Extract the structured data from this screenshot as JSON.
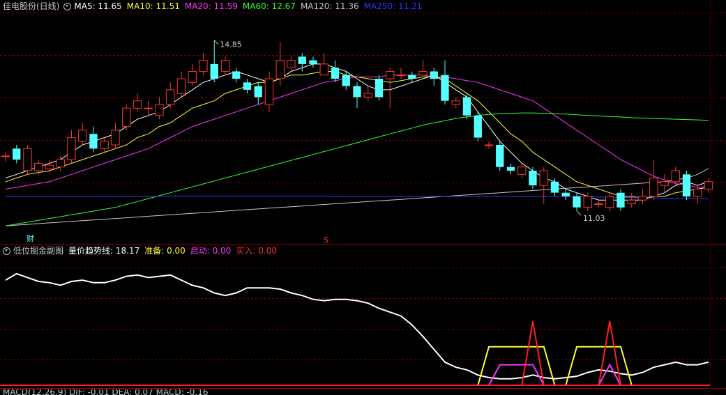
{
  "main_legend": {
    "title": "佳电股份(日线)",
    "ma": [
      {
        "label": "MA5: 11.65",
        "color": "#ffffff"
      },
      {
        "label": "MA10: 11.51",
        "color": "#ffff33"
      },
      {
        "label": "MA20: 11.59",
        "color": "#ff33ff"
      },
      {
        "label": "MA60: 12.67",
        "color": "#33ff33"
      },
      {
        "label": "MA120: 11.36",
        "color": "#c8c8c8"
      },
      {
        "label": "MA250: 11.21",
        "color": "#3333ff"
      }
    ]
  },
  "annotations": {
    "high": "14.85",
    "low": "11.03",
    "marker_cai": "财",
    "marker_s": "S"
  },
  "sub_legend": {
    "title": "低位掘金副图",
    "items": [
      {
        "label": "量价趋势线: 18.17",
        "color": "#ffffff"
      },
      {
        "label": "准备: 0.00",
        "color": "#ffff33"
      },
      {
        "label": "启动: 0.00",
        "color": "#ff33ff"
      },
      {
        "label": "买入: 0.00",
        "color": "#ff3333"
      }
    ]
  },
  "bottom_legend": {
    "text": "MACD(12,26,9) DIF: -0.01 DEA: 0.07 MACD: -0.16"
  },
  "colors": {
    "up": "#ff3333",
    "down": "#54ffff",
    "grid": "#7a0000",
    "border": "#a00000"
  },
  "chart_data": [
    {
      "type": "candlestick",
      "title": "佳电股份(日线)",
      "ylim": [
        9.5,
        15.6
      ],
      "candles": [
        [
          11.7,
          11.7,
          11.8,
          11.55
        ],
        [
          11.9,
          11.6,
          12.0,
          11.5
        ],
        [
          11.3,
          11.9,
          12.0,
          11.2
        ],
        [
          11.3,
          11.5,
          11.6,
          11.2
        ],
        [
          11.35,
          11.45,
          11.6,
          11.25
        ],
        [
          11.4,
          11.6,
          11.7,
          11.3
        ],
        [
          11.6,
          12.2,
          12.4,
          11.5
        ],
        [
          12.1,
          12.4,
          12.6,
          12.0
        ],
        [
          12.3,
          11.9,
          12.5,
          11.8
        ],
        [
          11.9,
          12.1,
          12.2,
          11.8
        ],
        [
          12.0,
          12.4,
          12.6,
          11.9
        ],
        [
          12.5,
          13.0,
          13.1,
          12.4
        ],
        [
          13.0,
          13.2,
          13.4,
          12.9
        ],
        [
          13.0,
          13.0,
          13.2,
          12.8
        ],
        [
          12.8,
          13.1,
          13.3,
          12.7
        ],
        [
          13.1,
          13.5,
          13.7,
          13.0
        ],
        [
          13.4,
          13.8,
          14.0,
          13.3
        ],
        [
          13.7,
          14.0,
          14.2,
          13.6
        ],
        [
          14.0,
          14.3,
          14.5,
          13.9
        ],
        [
          14.2,
          13.8,
          14.85,
          13.7
        ],
        [
          14.0,
          14.3,
          14.4,
          13.9
        ],
        [
          14.0,
          13.8,
          14.1,
          13.7
        ],
        [
          13.7,
          13.5,
          13.8,
          13.4
        ],
        [
          13.6,
          13.3,
          13.7,
          13.1
        ],
        [
          13.1,
          13.8,
          14.0,
          12.9
        ],
        [
          13.8,
          14.3,
          14.8,
          13.6
        ],
        [
          14.1,
          14.3,
          14.4,
          14.0
        ],
        [
          14.4,
          14.2,
          14.5,
          14.0
        ],
        [
          14.3,
          14.2,
          14.4,
          14.1
        ],
        [
          13.9,
          14.2,
          14.5,
          13.9
        ],
        [
          14.1,
          13.8,
          14.3,
          13.7
        ],
        [
          13.9,
          13.6,
          14.0,
          13.5
        ],
        [
          13.6,
          13.3,
          13.7,
          13.0
        ],
        [
          13.3,
          13.4,
          13.6,
          13.2
        ],
        [
          13.8,
          13.3,
          13.9,
          13.2
        ],
        [
          13.8,
          14.0,
          14.1,
          13.0
        ],
        [
          13.9,
          13.9,
          14.1,
          13.8
        ],
        [
          13.9,
          13.8,
          14.0,
          13.7
        ],
        [
          13.9,
          14.0,
          14.3,
          13.9
        ],
        [
          14.0,
          13.8,
          14.1,
          13.6
        ],
        [
          13.9,
          13.2,
          14.3,
          13.1
        ],
        [
          13.1,
          13.2,
          13.3,
          13.0
        ],
        [
          13.3,
          12.8,
          13.4,
          12.7
        ],
        [
          12.8,
          12.2,
          12.9,
          12.1
        ],
        [
          12.0,
          12.0,
          12.1,
          11.9
        ],
        [
          12.0,
          11.4,
          12.1,
          11.3
        ],
        [
          11.4,
          11.3,
          11.5,
          11.2
        ],
        [
          11.2,
          11.4,
          11.5,
          11.1
        ],
        [
          11.3,
          10.9,
          11.4,
          10.8
        ],
        [
          10.9,
          11.3,
          11.4,
          10.4
        ],
        [
          11.0,
          10.7,
          11.1,
          10.6
        ],
        [
          10.7,
          10.6,
          10.8,
          10.5
        ],
        [
          10.6,
          10.3,
          10.7,
          10.2
        ],
        [
          10.3,
          10.6,
          10.7,
          10.2
        ],
        [
          10.4,
          10.4,
          10.5,
          10.3
        ],
        [
          10.3,
          10.6,
          10.7,
          10.2
        ],
        [
          10.7,
          10.3,
          10.8,
          10.2
        ],
        [
          10.4,
          10.5,
          10.7,
          10.3
        ],
        [
          10.5,
          10.6,
          10.8,
          10.4
        ],
        [
          10.6,
          11.1,
          11.6,
          10.5
        ],
        [
          10.9,
          11.0,
          11.2,
          10.7
        ],
        [
          11.0,
          11.3,
          11.4,
          10.9
        ],
        [
          11.2,
          10.6,
          11.3,
          10.5
        ],
        [
          10.6,
          10.8,
          10.9,
          10.4
        ],
        [
          10.8,
          11.0,
          11.1,
          10.7
        ]
      ],
      "series": [
        {
          "name": "MA5",
          "values": [
            11.1,
            11.2,
            11.3,
            11.4,
            11.5,
            11.6,
            11.8,
            12.0,
            12.1,
            12.2,
            12.3,
            12.5,
            12.7,
            12.8,
            12.9,
            13.1,
            13.3,
            13.5,
            13.7,
            13.8,
            13.9,
            14.0,
            13.9,
            13.8,
            13.7,
            13.8,
            14.0,
            14.1,
            14.2,
            14.2,
            14.1,
            14.0,
            13.8,
            13.6,
            13.5,
            13.5,
            13.6,
            13.7,
            13.8,
            13.9,
            13.7,
            13.5,
            13.3,
            12.9,
            12.5,
            12.1,
            11.8,
            11.5,
            11.3,
            11.1,
            11.0,
            10.8,
            10.7,
            10.6,
            10.5,
            10.5,
            10.5,
            10.5,
            10.5,
            10.6,
            10.7,
            10.9,
            11.0,
            10.9,
            11.0
          ]
        },
        {
          "name": "MA10",
          "values": [
            11.0,
            11.1,
            11.2,
            11.25,
            11.3,
            11.4,
            11.5,
            11.6,
            11.7,
            11.8,
            11.9,
            12.0,
            12.2,
            12.3,
            12.5,
            12.6,
            12.8,
            13.0,
            13.1,
            13.2,
            13.4,
            13.5,
            13.6,
            13.7,
            13.7,
            13.8,
            13.9,
            13.9,
            13.95,
            14.0,
            14.0,
            13.9,
            13.85,
            13.8,
            13.75,
            13.7,
            13.75,
            13.8,
            13.85,
            13.85,
            13.8,
            13.6,
            13.4,
            13.2,
            12.9,
            12.6,
            12.3,
            12.1,
            11.8,
            11.6,
            11.4,
            11.2,
            11.0,
            10.9,
            10.8,
            10.7,
            10.6,
            10.6,
            10.55,
            10.6,
            10.6,
            10.7,
            10.75,
            10.8,
            10.85
          ]
        },
        {
          "name": "MA20",
          "values": [
            10.8,
            10.85,
            10.9,
            10.95,
            11.0,
            11.1,
            11.2,
            11.3,
            11.4,
            11.5,
            11.6,
            11.7,
            11.8,
            11.9,
            12.05,
            12.2,
            12.35,
            12.5,
            12.6,
            12.7,
            12.8,
            12.9,
            13.0,
            13.1,
            13.2,
            13.3,
            13.4,
            13.5,
            13.6,
            13.7,
            13.75,
            13.8,
            13.85,
            13.85,
            13.85,
            13.9,
            13.9,
            13.9,
            13.9,
            13.85,
            13.85,
            13.8,
            13.75,
            13.7,
            13.6,
            13.5,
            13.4,
            13.3,
            13.2,
            13.0,
            12.8,
            12.6,
            12.4,
            12.2,
            12.0,
            11.8,
            11.6,
            11.45,
            11.3,
            11.15,
            11.05,
            10.95,
            10.9,
            10.85,
            10.85
          ]
        },
        {
          "name": "MA60",
          "values": [
            9.8,
            9.85,
            9.9,
            9.95,
            10.0,
            10.05,
            10.1,
            10.15,
            10.2,
            10.25,
            10.3,
            10.38,
            10.46,
            10.54,
            10.62,
            10.7,
            10.78,
            10.86,
            10.94,
            11.02,
            11.1,
            11.18,
            11.26,
            11.34,
            11.42,
            11.5,
            11.58,
            11.66,
            11.74,
            11.82,
            11.9,
            11.98,
            12.06,
            12.14,
            12.22,
            12.3,
            12.38,
            12.46,
            12.54,
            12.6,
            12.66,
            12.72,
            12.76,
            12.8,
            12.83,
            12.85,
            12.86,
            12.87,
            12.87,
            12.86,
            12.85,
            12.84,
            12.82,
            12.8,
            12.79,
            12.77,
            12.76,
            12.74,
            12.73,
            12.72,
            12.71,
            12.7,
            12.69,
            12.68,
            12.67
          ]
        },
        {
          "name": "MA120",
          "values": [
            9.8,
            9.82,
            9.84,
            9.86,
            9.88,
            9.9,
            9.92,
            9.94,
            9.96,
            9.98,
            10.0,
            10.02,
            10.04,
            10.06,
            10.08,
            10.1,
            10.12,
            10.14,
            10.16,
            10.18,
            10.2,
            10.22,
            10.24,
            10.26,
            10.28,
            10.3,
            10.32,
            10.34,
            10.36,
            10.38,
            10.4,
            10.42,
            10.44,
            10.46,
            10.48,
            10.5,
            10.52,
            10.54,
            10.56,
            10.58,
            10.6,
            10.62,
            10.64,
            10.66,
            10.68,
            10.7,
            10.72,
            10.74,
            10.76,
            10.78,
            10.8,
            10.82,
            10.84,
            10.86,
            10.88,
            10.9,
            10.92,
            10.94,
            10.96,
            10.98,
            11.0,
            11.05,
            11.1,
            11.2,
            11.36
          ]
        },
        {
          "name": "MA250",
          "values": [
            10.6,
            10.6,
            10.6,
            10.6,
            10.6,
            10.6,
            10.6,
            10.6,
            10.6,
            10.6,
            10.6,
            10.6,
            10.6,
            10.6,
            10.6,
            10.61,
            10.61,
            10.61,
            10.61,
            10.61,
            10.61,
            10.61,
            10.61,
            10.61,
            10.61,
            10.61,
            10.61,
            10.61,
            10.61,
            10.61,
            10.6,
            10.6,
            10.6,
            10.6,
            10.6,
            10.6,
            10.6,
            10.6,
            10.6,
            10.6,
            10.6,
            10.6,
            10.6,
            10.6,
            10.6,
            10.6,
            10.6,
            10.6,
            10.6,
            10.6,
            10.6,
            10.6,
            10.6,
            10.6,
            10.58,
            10.58,
            10.57,
            10.57,
            10.56,
            10.56,
            10.55,
            10.55,
            10.54,
            10.54,
            10.53
          ]
        }
      ]
    },
    {
      "type": "line",
      "title": "低位掘金副图",
      "ylim": [
        0,
        100
      ],
      "series": [
        {
          "name": "量价趋势线",
          "values": [
            82,
            87,
            84,
            81,
            80,
            78,
            81,
            82,
            80,
            80,
            82,
            85,
            86,
            84,
            85,
            86,
            82,
            78,
            76,
            72,
            70,
            72,
            76,
            76,
            76,
            75,
            72,
            70,
            67,
            66,
            67,
            67,
            66,
            64,
            60,
            57,
            54,
            47,
            38,
            28,
            18,
            14,
            12,
            8,
            6,
            5,
            5,
            6,
            8,
            6,
            5,
            6,
            7,
            10,
            12,
            11,
            9,
            8,
            10,
            14,
            16,
            18,
            16,
            16,
            18
          ]
        },
        {
          "name": "准备",
          "values": [
            0,
            0,
            0,
            0,
            0,
            0,
            0,
            0,
            0,
            0,
            0,
            0,
            0,
            0,
            0,
            0,
            0,
            0,
            0,
            0,
            0,
            0,
            0,
            0,
            0,
            0,
            0,
            0,
            0,
            0,
            0,
            0,
            0,
            0,
            0,
            0,
            0,
            0,
            0,
            0,
            0,
            0,
            0,
            0,
            30,
            30,
            30,
            30,
            30,
            30,
            0,
            0,
            30,
            30,
            30,
            30,
            30,
            0,
            0,
            0,
            0,
            0,
            0,
            0,
            0
          ]
        },
        {
          "name": "启动",
          "values": [
            0,
            0,
            0,
            0,
            0,
            0,
            0,
            0,
            0,
            0,
            0,
            0,
            0,
            0,
            0,
            0,
            0,
            0,
            0,
            0,
            0,
            0,
            0,
            0,
            0,
            0,
            0,
            0,
            0,
            0,
            0,
            0,
            0,
            0,
            0,
            0,
            0,
            0,
            0,
            0,
            0,
            0,
            0,
            0,
            0,
            16,
            16,
            16,
            16,
            0,
            0,
            0,
            0,
            0,
            0,
            16,
            0,
            0,
            0,
            0,
            0,
            0,
            0,
            0,
            0
          ]
        },
        {
          "name": "买入",
          "values": [
            0,
            0,
            0,
            0,
            0,
            0,
            0,
            0,
            0,
            0,
            0,
            0,
            0,
            0,
            0,
            0,
            0,
            0,
            0,
            0,
            0,
            0,
            0,
            0,
            0,
            0,
            0,
            0,
            0,
            0,
            0,
            0,
            0,
            0,
            0,
            0,
            0,
            0,
            0,
            0,
            0,
            0,
            0,
            0,
            0,
            0,
            0,
            0,
            50,
            0,
            0,
            0,
            0,
            0,
            0,
            50,
            0,
            0,
            0,
            0,
            0,
            0,
            0,
            0,
            0
          ]
        }
      ]
    }
  ]
}
